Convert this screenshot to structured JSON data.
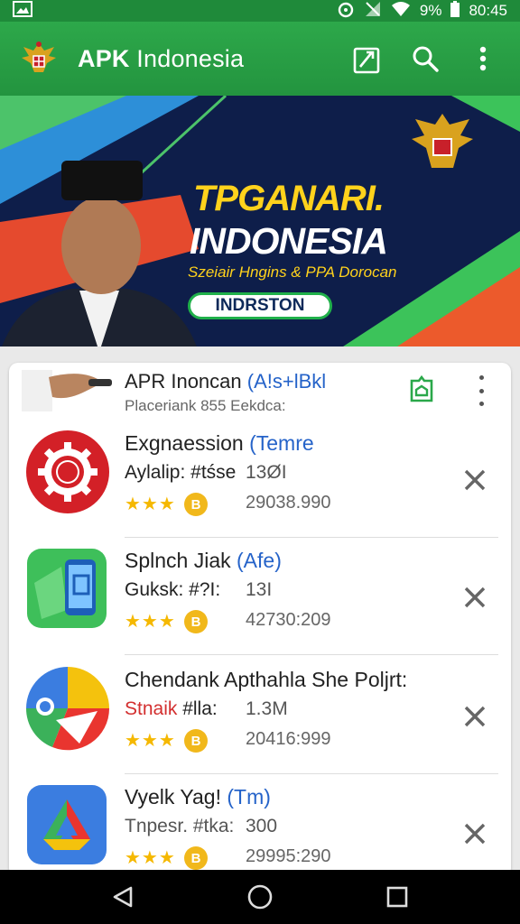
{
  "status": {
    "battery": "9%",
    "time": "80:45"
  },
  "appbar": {
    "title_bold": "APK",
    "title_rest": " Indonesia"
  },
  "banner": {
    "headline1": "TPGANARI.",
    "headline2": "INDONESIA",
    "subline": "Szeiair Hngins & PPA Dorocan",
    "button": "INDRSTON"
  },
  "featured": {
    "title": "APR Inoncan ",
    "title_accent": "(A!s+lBkl",
    "subtitle": "Placeriank 855 Eekdca:"
  },
  "apps": [
    {
      "name": "Exgnaession ",
      "accent": "(Temre",
      "developer": "Aylalip: #tśse",
      "dev_red": false,
      "size": "13ØI",
      "stars": "★★★",
      "downloads": "29038.990",
      "icon": "gear-icon",
      "color": "#d32027"
    },
    {
      "name": "Splnch Jiak ",
      "accent": "(Afe)",
      "developer": "Guksk: #?I:",
      "dev_red": false,
      "size": "13I",
      "stars": "★★★",
      "downloads": "42730:209",
      "icon": "phone-icon",
      "color": "#3ebf5a"
    },
    {
      "name": "Chendank Apthahla She Poljrt:",
      "accent": "",
      "developer": "Stnaik",
      "developer_rest": " #lla:",
      "dev_red": true,
      "size": "1.3M",
      "stars": "★★★",
      "downloads": "20416:999",
      "icon": "chrome-icon",
      "color": "#e9352f"
    },
    {
      "name": "Vyelk Yag! ",
      "accent": "(Tm)",
      "developer": "Tnpesr. #tka:",
      "dev_red": false,
      "size": "300",
      "stars": "★★★",
      "downloads": "29995:290",
      "icon": "drive-icon",
      "color": "#3b7de0"
    }
  ],
  "coin_label": "B"
}
